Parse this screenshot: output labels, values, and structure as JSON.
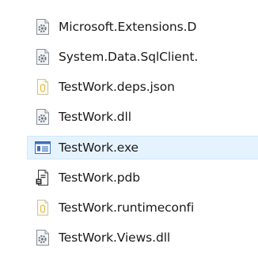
{
  "files": [
    {
      "name": "Microsoft.Extensions.D",
      "icon": "dll-gear-icon",
      "selected": false
    },
    {
      "name": "System.Data.SqlClient.",
      "icon": "dll-gear-icon",
      "selected": false
    },
    {
      "name": "TestWork.deps.json",
      "icon": "json-file-icon",
      "selected": false
    },
    {
      "name": "TestWork.dll",
      "icon": "dll-gear-icon",
      "selected": false
    },
    {
      "name": "TestWork.exe",
      "icon": "exe-window-icon",
      "selected": true
    },
    {
      "name": "TestWork.pdb",
      "icon": "pdb-file-icon",
      "selected": false
    },
    {
      "name": "TestWork.runtimeconfi",
      "icon": "json-file-icon",
      "selected": false
    },
    {
      "name": "TestWork.Views.dll",
      "icon": "dll-gear-icon",
      "selected": false
    }
  ],
  "colors": {
    "selection_fill": "#e5f3ff",
    "selection_border": "#cde8ff",
    "text": "#1a1a1a"
  }
}
